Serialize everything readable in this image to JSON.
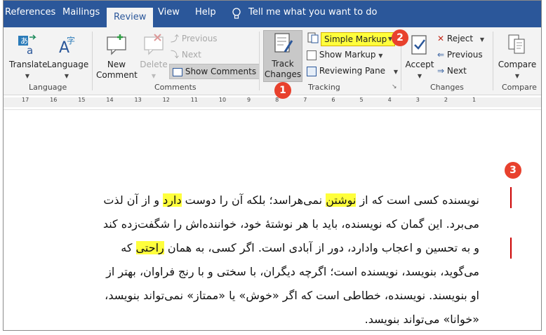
{
  "tabs": [
    {
      "label": "References"
    },
    {
      "label": "Mailings"
    },
    {
      "label": "Review"
    },
    {
      "label": "View"
    },
    {
      "label": "Help"
    }
  ],
  "tell_me": "Tell me what you want to do",
  "groups": {
    "language": {
      "label": "Language",
      "translate": "Translate",
      "language": "Language"
    },
    "comments": {
      "label": "Comments",
      "new_comment": [
        "New",
        "Comment"
      ],
      "delete": "Delete",
      "previous": "Previous",
      "next": "Next",
      "show_comments": "Show Comments"
    },
    "tracking": {
      "label": "Tracking",
      "track_changes": [
        "Track",
        "Changes"
      ],
      "simple_markup": "Simple Markup",
      "show_markup": "Show Markup",
      "reviewing_pane": "Reviewing Pane"
    },
    "changes": {
      "label": "Changes",
      "accept": "Accept",
      "reject": "Reject",
      "previous": "Previous",
      "next": "Next"
    },
    "compare": {
      "label": "Compare",
      "compare": "Compare"
    }
  },
  "ruler_ticks": [
    "17",
    "16",
    "15",
    "14",
    "13",
    "12",
    "11",
    "10",
    "9",
    "8",
    "7",
    "6",
    "5",
    "4",
    "3",
    "2",
    "1"
  ],
  "badges": [
    "1",
    "2",
    "3"
  ],
  "document": {
    "lines": [
      [
        "نویسنده کسی است که از ",
        "نوشتن",
        " نمی‌هراسد؛ بلکه آن را دوست ",
        "دارد",
        " و از آن لذت"
      ],
      [
        "می‌برد. این گمان که نویسنده، باید با هر نوشتهٔ خود، خواننده‌اش را شگفت‌زده کند"
      ],
      [
        "و به تحسین و اعجاب وادارد، دور از آبادی است. اگر کسی، به همان ",
        "راحتی",
        " که"
      ],
      [
        "می‌گوید، بنویسد، نویسنده است؛ اگرچه دیگران، با سختی و با رنج فراوان، بهتر از"
      ],
      [
        "او بنویسند. نویسنده، خطاطی است که اگر «خوش» یا «ممتاز» نمی‌تواند بنویسد،"
      ],
      [
        "«خوانا» می‌تواند بنویسد."
      ]
    ]
  },
  "colors": {
    "tab_bar": "#2b579a",
    "highlight": "#ffff3c",
    "badge": "#e8412d",
    "change_bar": "#cc0000"
  }
}
